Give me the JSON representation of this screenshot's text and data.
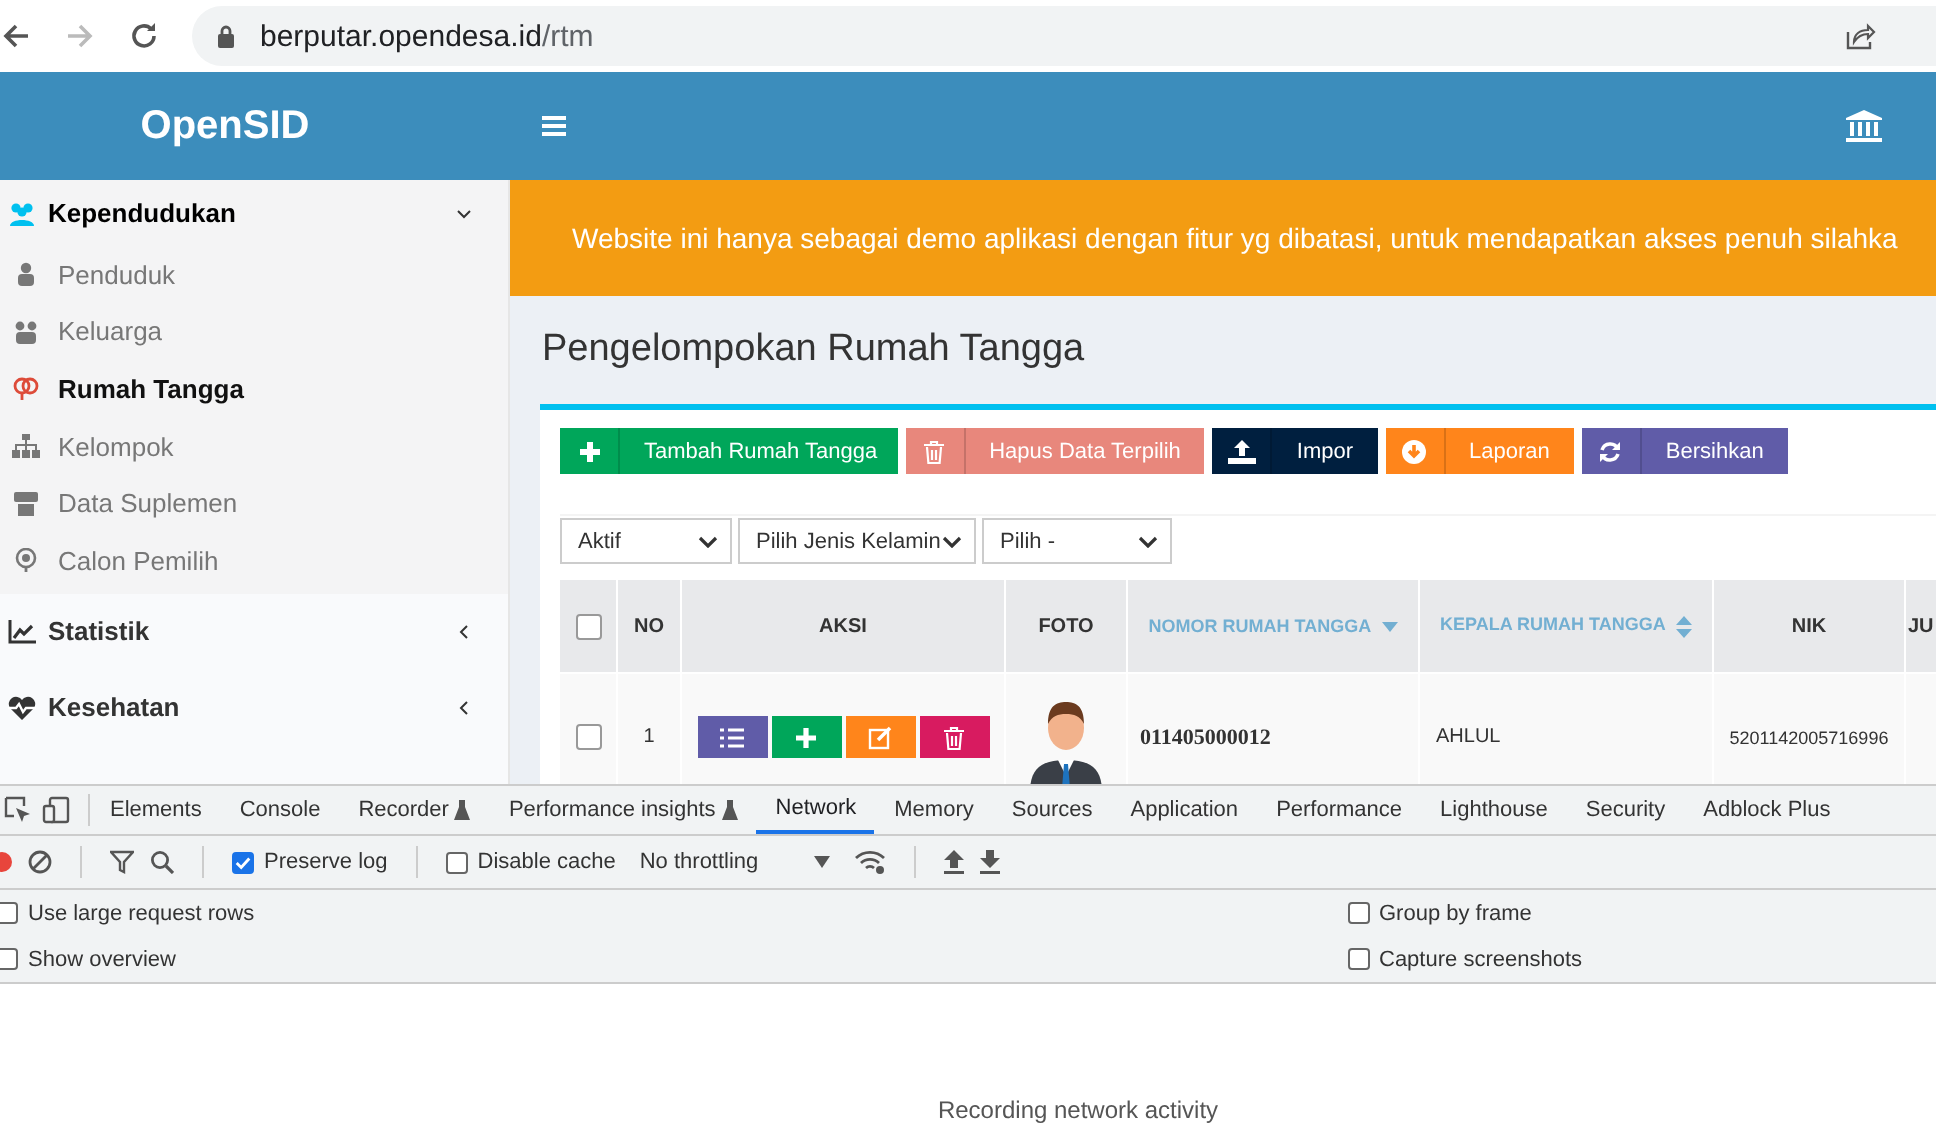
{
  "browser": {
    "url_host": "berputar.opendesa.id",
    "url_path": "/rtm"
  },
  "header": {
    "brand": "OpenSID"
  },
  "sidebar": {
    "sections": [
      {
        "label": "Kependudukan",
        "expanded": true,
        "children": [
          {
            "label": "Penduduk",
            "selected": false
          },
          {
            "label": "Keluarga",
            "selected": false
          },
          {
            "label": "Rumah Tangga",
            "selected": true
          },
          {
            "label": "Kelompok",
            "selected": false
          },
          {
            "label": "Data Suplemen",
            "selected": false
          },
          {
            "label": "Calon Pemilih",
            "selected": false
          }
        ]
      },
      {
        "label": "Statistik",
        "expanded": false
      },
      {
        "label": "Kesehatan",
        "expanded": false
      }
    ]
  },
  "notice": "Website ini hanya sebagai demo aplikasi dengan fitur yg dibatasi, untuk mendapatkan akses penuh silahka",
  "page_title": "Pengelompokan Rumah Tangga",
  "toolbar_buttons": [
    {
      "label": "Tambah Rumah Tangga",
      "color": "#00a65a"
    },
    {
      "label": "Hapus Data Terpilih",
      "color": "#e8877c"
    },
    {
      "label": "Impor",
      "color": "#001f3f"
    },
    {
      "label": "Laporan",
      "color": "#ff851b"
    },
    {
      "label": "Bersihkan",
      "color": "#605ca8"
    }
  ],
  "filters": [
    {
      "value": "Aktif"
    },
    {
      "value": "Pilih Jenis Kelamin"
    },
    {
      "value": "Pilih -"
    }
  ],
  "table": {
    "select_all_checked": false,
    "columns": [
      {
        "label": "NO"
      },
      {
        "label": "AKSI"
      },
      {
        "label": "FOTO"
      },
      {
        "label": "NOMOR RUMAH TANGGA",
        "sortable": true,
        "sorted": true
      },
      {
        "label": "KEPALA RUMAH TANGGA",
        "sortable": true,
        "sorted": false
      },
      {
        "label": "NIK"
      },
      {
        "label": "JU"
      }
    ],
    "rows": [
      {
        "checked": false,
        "no": "1",
        "nomor": "011405000012",
        "kepala": "AHLUL",
        "nik": "5201142005716996",
        "actions": [
          {
            "color": "#605ca8"
          },
          {
            "color": "#00a65a"
          },
          {
            "color": "#ff851b"
          },
          {
            "color": "#d81b60"
          }
        ]
      }
    ]
  },
  "devtools": {
    "tabs": [
      {
        "label": "Elements",
        "selected": false,
        "kind": "plain"
      },
      {
        "label": "Console",
        "selected": false,
        "kind": "plain"
      },
      {
        "label": "Recorder",
        "selected": false,
        "kind": "experimental"
      },
      {
        "label": "Performance insights",
        "selected": false,
        "kind": "experimental"
      },
      {
        "label": "Network",
        "selected": true,
        "kind": "plain"
      },
      {
        "label": "Memory",
        "selected": false,
        "kind": "plain"
      },
      {
        "label": "Sources",
        "selected": false,
        "kind": "plain"
      },
      {
        "label": "Application",
        "selected": false,
        "kind": "plain"
      },
      {
        "label": "Performance",
        "selected": false,
        "kind": "plain"
      },
      {
        "label": "Lighthouse",
        "selected": false,
        "kind": "plain"
      },
      {
        "label": "Security",
        "selected": false,
        "kind": "plain"
      },
      {
        "label": "Adblock Plus",
        "selected": false,
        "kind": "plain"
      }
    ],
    "preserve_log": {
      "label": "Preserve log",
      "checked": true
    },
    "disable_cache": {
      "label": "Disable cache",
      "checked": false
    },
    "throttling": "No throttling",
    "settings_left": [
      {
        "label": "Use large request rows",
        "checked": false
      },
      {
        "label": "Show overview",
        "checked": false
      }
    ],
    "settings_right": [
      {
        "label": "Group by frame",
        "checked": false
      },
      {
        "label": "Capture screenshots",
        "checked": false
      }
    ],
    "empty_message": "Recording network activity"
  }
}
